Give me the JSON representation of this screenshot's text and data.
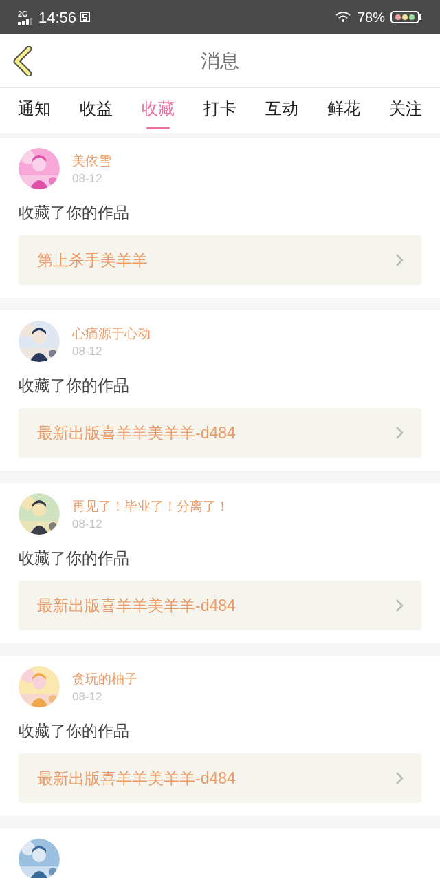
{
  "status_bar": {
    "network": "2G",
    "time": "14:56",
    "battery": "78%"
  },
  "header": {
    "title": "消息"
  },
  "tabs": [
    {
      "label": "通知",
      "selected": false
    },
    {
      "label": "收益",
      "selected": false
    },
    {
      "label": "收藏",
      "selected": true
    },
    {
      "label": "打卡",
      "selected": false
    },
    {
      "label": "互动",
      "selected": false
    },
    {
      "label": "鲜花",
      "selected": false
    },
    {
      "label": "关注",
      "selected": false
    }
  ],
  "messages": [
    {
      "avatar": {
        "kind": "picture"
      },
      "name": "美依雪",
      "date": "08-12",
      "text": "收藏了你的作品",
      "work": "第上杀手美羊羊"
    },
    {
      "avatar": {
        "kind": "picture"
      },
      "name": "心痛源于心动",
      "date": "08-12",
      "text": "收藏了你的作品",
      "work": "最新出版喜羊羊美羊羊-d484"
    },
    {
      "avatar": {
        "kind": "picture"
      },
      "name": "再见了！毕业了！分离了！",
      "date": "08-12",
      "text": "收藏了你的作品",
      "work": "最新出版喜羊羊美羊羊-d484"
    },
    {
      "avatar": {
        "kind": "picture"
      },
      "name": "贪玩的柚子",
      "date": "08-12",
      "text": "收藏了你的作品",
      "work": "最新出版喜羊羊美羊羊-d484"
    },
    {
      "avatar": {
        "kind": "picture"
      }
    }
  ]
}
